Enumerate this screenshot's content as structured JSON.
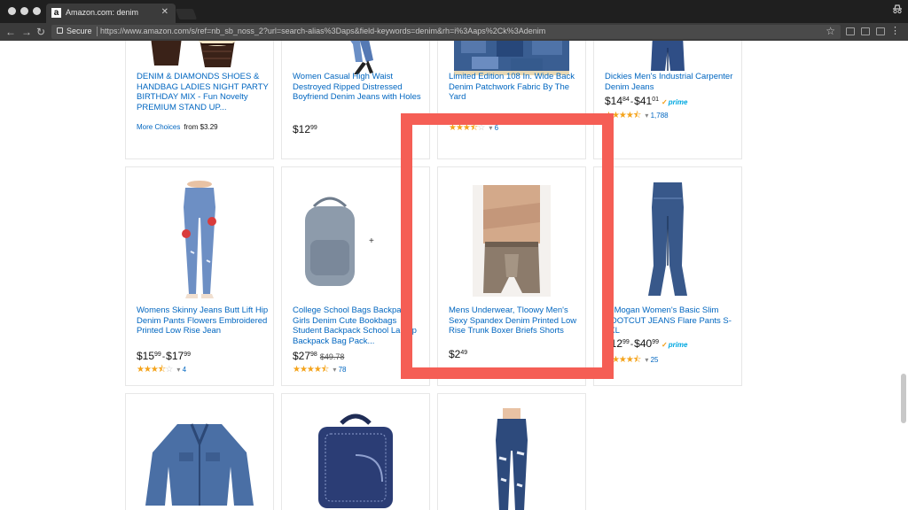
{
  "browser": {
    "tab_title": "Amazon.com: denim",
    "tab_favicon": "a",
    "secure_label": "Secure",
    "url": "https://www.amazon.com/s/ref=nb_sb_noss_2?url=search-alias%3Daps&field-keywords=denim&rh=i%3Aaps%2Ck%3Adenim"
  },
  "products": [
    {
      "title": "DENIM & DIAMONDS SHOES & HANDBAG LADIES NIGHT PARTY BIRTHDAY MIX - Fun Novelty PREMIUM STAND UP...",
      "more_choices": "More Choices",
      "from_price": "from $3.29",
      "image": "cupcakes"
    },
    {
      "title": "Women Casual High Waist Destroyed Ripped Distressed Boyfriend Denim Jeans with Holes",
      "price_whole": "$12",
      "price_frac": "99",
      "image": "jeans-legs"
    },
    {
      "title": "Limited Edition 108 In. Wide Back Denim Patchwork Fabric By The Yard",
      "rating": 3.5,
      "review_count": "6",
      "image": "denim-fabric"
    },
    {
      "title": "Dickies Men's Industrial Carpenter Denim Jeans",
      "price_low_whole": "$14",
      "price_low_frac": "84",
      "price_high_whole": "$41",
      "price_high_frac": "01",
      "prime": "prime",
      "rating": 4.5,
      "review_count": "1,788",
      "image": "dickies-jeans"
    },
    {
      "title": "Womens Skinny Jeans Butt Lift Hip Denim Pants Flowers Embroidered Printed Low Rise Jean",
      "price_low_whole": "$15",
      "price_low_frac": "99",
      "price_high_whole": "$17",
      "price_high_frac": "99",
      "rating": 3.5,
      "review_count": "4",
      "image": "skinny-jeans"
    },
    {
      "title": "College School Bags Backpack Girls Denim Cute Bookbags Student Backpack School Laptop Backpack Bag Pack...",
      "price_whole": "$27",
      "price_frac": "98",
      "list_price": "$49.78",
      "rating": 4.5,
      "review_count": "78",
      "image": "backpack"
    },
    {
      "title": "Mens Underwear, Tloowy Men's Sexy Spandex Denim Printed Low Rise Trunk Boxer Briefs Shorts",
      "price_whole": "$2",
      "price_frac": "49",
      "image": "underwear"
    },
    {
      "title": "LeMogan Women's Basic Slim BOOTCUT JEANS Flare Pants S-3XL",
      "price_low_whole": "$12",
      "price_low_frac": "99",
      "price_high_whole": "$40",
      "price_high_frac": "99",
      "prime": "prime",
      "rating": 4.5,
      "review_count": "25",
      "image": "bootcut-jeans"
    },
    {
      "title": "",
      "image": "denim-jacket"
    },
    {
      "title": "",
      "image": "denim-case"
    },
    {
      "title": "",
      "image": "ripped-jeans"
    }
  ],
  "colors": {
    "highlight": "#f55e55",
    "link": "#0066c0",
    "star": "#f4a31b"
  }
}
